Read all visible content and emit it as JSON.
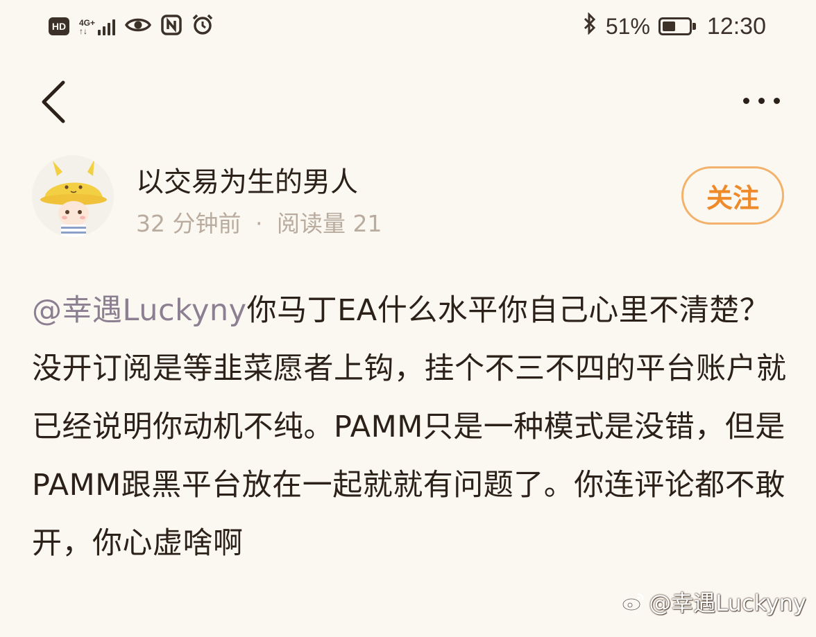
{
  "status_bar": {
    "hd_label": "HD",
    "network_type_top": "4G+",
    "network_type_bottom": "↑↓",
    "battery_percent": "51%",
    "battery_level": 0.51,
    "time": "12:30",
    "icons": [
      "hd-icon",
      "signal-icon",
      "eye-icon",
      "nfc-icon",
      "alarm-icon",
      "bluetooth-icon",
      "battery-icon"
    ]
  },
  "nav": {
    "back_icon": "chevron-left-icon",
    "more_icon": "more-dots-icon"
  },
  "author": {
    "name": "以交易为生的男人",
    "time_ago": "32 分钟前",
    "separator": "·",
    "read_count_label": "阅读量 21",
    "follow_label": "关注",
    "avatar_icon": "avatar-cartoon-icon"
  },
  "post": {
    "mention": "@幸遇Luckyny",
    "text": "你马丁EA什么水平你自己心里不清楚？没开订阅是等韭菜愿者上钩，挂个不三不四的平台账户就已经说明你动机不纯。PAMM只是一种模式是没错，但是PAMM跟黑平台放在一起就就有问题了。你连评论都不敢开，你心虚啥啊"
  },
  "watermark": {
    "text": "@幸遇Luckyny",
    "icon": "weibo-logo-icon"
  },
  "colors": {
    "background": "#fbf8f2",
    "text": "#2b2118",
    "muted": "#b9ab9d",
    "mention": "#8c7f91",
    "follow_accent": "#ef8a2a"
  }
}
